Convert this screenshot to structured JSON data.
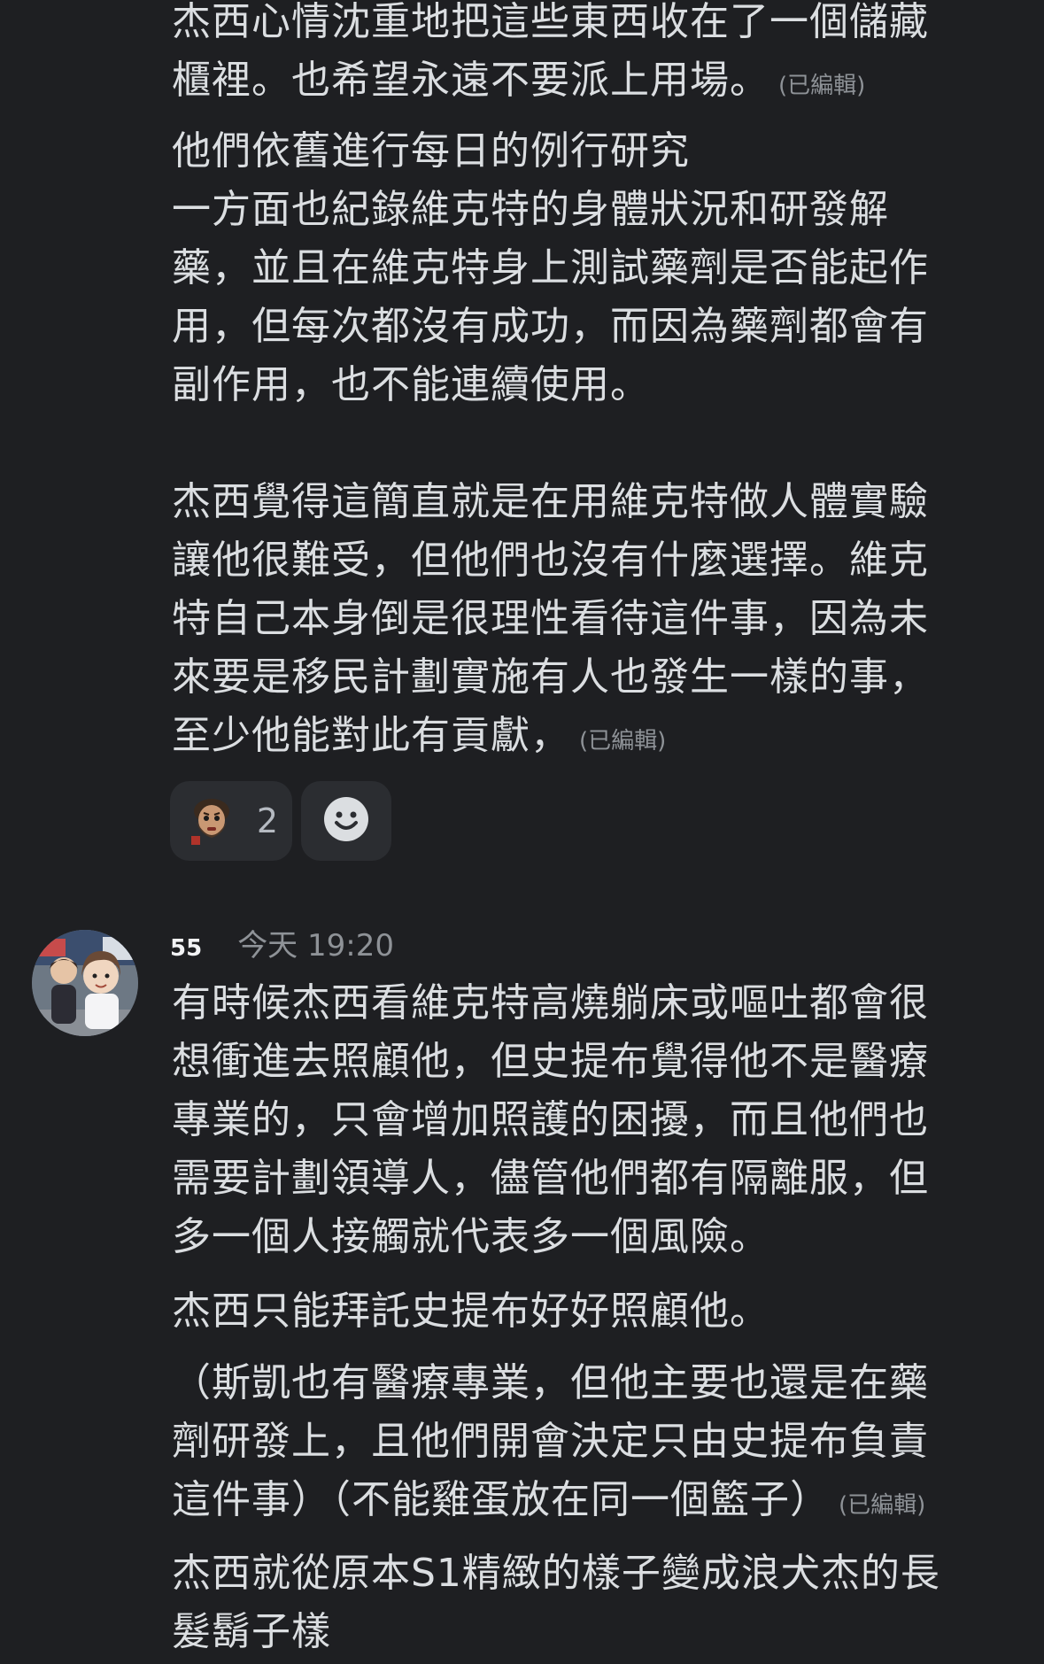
{
  "chat": {
    "message1": {
      "p1_lines": "杰西心情沈重地把這些東西收在了一個儲藏\n櫃裡。也希望永遠不要派上用場。",
      "p1_edited": "(已編輯)",
      "p2_lines": "他們依舊進行每日的例行研究\n一方面也紀錄維克特的身體狀況和研發解\n藥，並且在維克特身上測試藥劑是否能起作\n用，但每次都沒有成功，而因為藥劑都會有\n副作用，也不能連續使用。\n\n杰西覺得這簡直就是在用維克特做人體實驗\n讓他很難受，但他們也沒有什麼選擇。維克\n特自己本身倒是很理性看待這件事，因為未\n來要是移民計劃實施有人也發生一樣的事，\n至少他能對此有貢獻，",
      "p2_edited": "(已編輯)"
    },
    "reactions": [
      {
        "icon": "custom-emoji-bearded-man-icon",
        "count": "2"
      },
      {
        "icon": "add-reaction-smiley-icon"
      }
    ],
    "message2": {
      "username": "55",
      "timestamp": "今天 19:20",
      "p1_lines": "有時候杰西看維克特高燒躺床或嘔吐都會很\n想衝進去照顧他，但史提布覺得他不是醫療\n專業的，只會增加照護的困擾，而且他們也\n需要計劃領導人，儘管他們都有隔離服，但\n多一個人接觸就代表多一個風險。",
      "p2": "杰西只能拜託史提布好好照顧他。",
      "p3_lines": "（斯凱也有醫療專業，但他主要也還是在藥\n劑研發上，且他們開會決定只由史提布負責\n這件事）（不能雞蛋放在同一個籃子）",
      "p3_edited": "(已編輯)",
      "p4_lines": "杰西就從原本S1精緻的樣子變成浪犬杰的長\n髮鬍子樣"
    }
  }
}
